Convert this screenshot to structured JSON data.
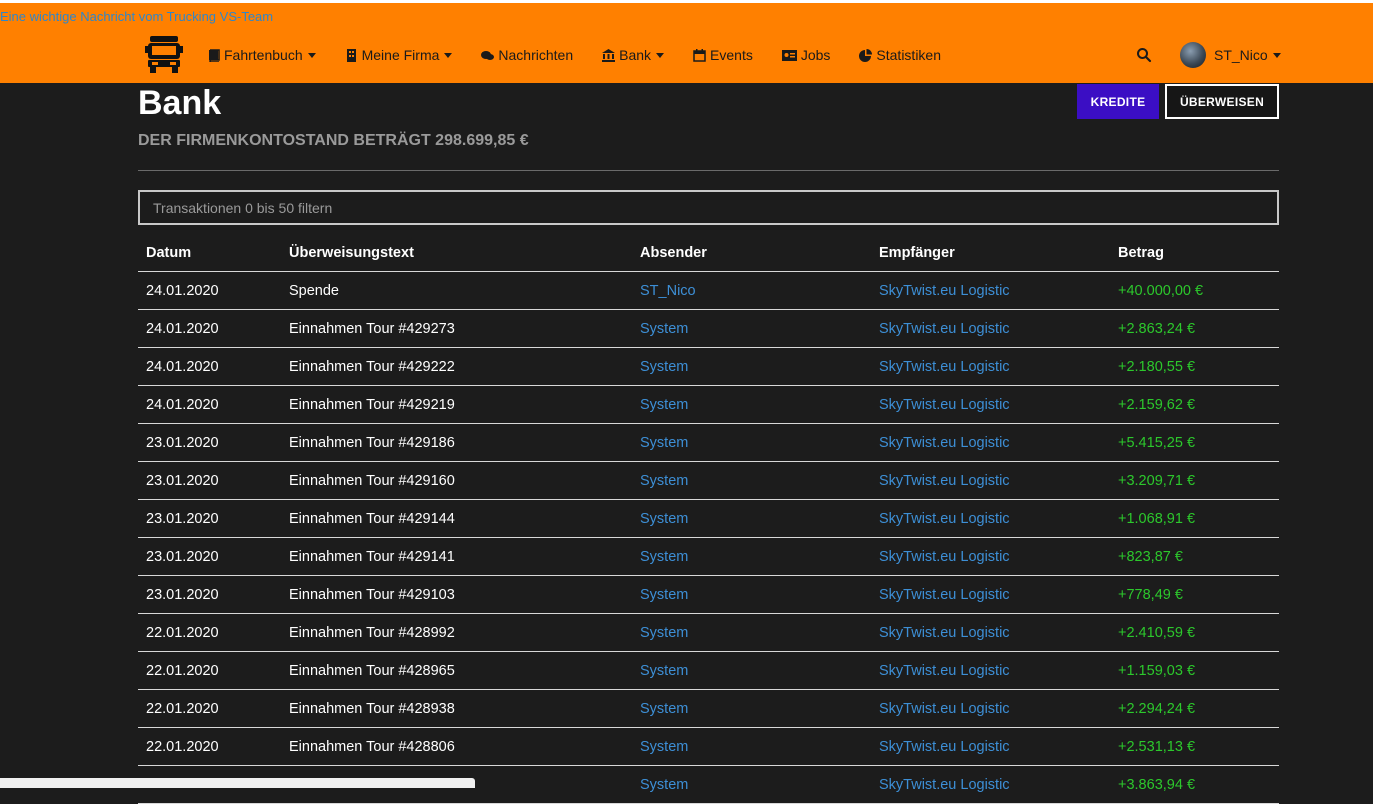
{
  "notice": "Eine wichtige Nachricht vom Trucking VS-Team",
  "nav": {
    "items": [
      {
        "label": "Fahrtenbuch",
        "icon": "book-icon",
        "dropdown": true
      },
      {
        "label": "Meine Firma",
        "icon": "building-icon",
        "dropdown": true
      },
      {
        "label": "Nachrichten",
        "icon": "chat-icon",
        "dropdown": false
      },
      {
        "label": "Bank",
        "icon": "bank-icon",
        "dropdown": true
      },
      {
        "label": "Events",
        "icon": "calendar-icon",
        "dropdown": false
      },
      {
        "label": "Jobs",
        "icon": "id-card-icon",
        "dropdown": false
      },
      {
        "label": "Statistiken",
        "icon": "pie-chart-icon",
        "dropdown": false
      }
    ],
    "user": "ST_Nico"
  },
  "page": {
    "title": "Bank",
    "balance": "Der Firmenkontostand beträgt 298.699,85 €",
    "kredite_label": "KREDITE",
    "ueberweisen_label": "ÜBERWEISEN",
    "filter_placeholder": "Transaktionen 0 bis 50 filtern"
  },
  "table": {
    "columns": [
      "Datum",
      "Überweisungstext",
      "Absender",
      "Empfänger",
      "Betrag"
    ],
    "rows": [
      [
        "24.01.2020",
        "Spende",
        "ST_Nico",
        "SkyTwist.eu Logistic",
        "+40.000,00 €"
      ],
      [
        "24.01.2020",
        "Einnahmen Tour #429273",
        "System",
        "SkyTwist.eu Logistic",
        "+2.863,24 €"
      ],
      [
        "24.01.2020",
        "Einnahmen Tour #429222",
        "System",
        "SkyTwist.eu Logistic",
        "+2.180,55 €"
      ],
      [
        "24.01.2020",
        "Einnahmen Tour #429219",
        "System",
        "SkyTwist.eu Logistic",
        "+2.159,62 €"
      ],
      [
        "23.01.2020",
        "Einnahmen Tour #429186",
        "System",
        "SkyTwist.eu Logistic",
        "+5.415,25 €"
      ],
      [
        "23.01.2020",
        "Einnahmen Tour #429160",
        "System",
        "SkyTwist.eu Logistic",
        "+3.209,71 €"
      ],
      [
        "23.01.2020",
        "Einnahmen Tour #429144",
        "System",
        "SkyTwist.eu Logistic",
        "+1.068,91 €"
      ],
      [
        "23.01.2020",
        "Einnahmen Tour #429141",
        "System",
        "SkyTwist.eu Logistic",
        "+823,87 €"
      ],
      [
        "23.01.2020",
        "Einnahmen Tour #429103",
        "System",
        "SkyTwist.eu Logistic",
        "+778,49 €"
      ],
      [
        "22.01.2020",
        "Einnahmen Tour #428992",
        "System",
        "SkyTwist.eu Logistic",
        "+2.410,59 €"
      ],
      [
        "22.01.2020",
        "Einnahmen Tour #428965",
        "System",
        "SkyTwist.eu Logistic",
        "+1.159,03 €"
      ],
      [
        "22.01.2020",
        "Einnahmen Tour #428938",
        "System",
        "SkyTwist.eu Logistic",
        "+2.294,24 €"
      ],
      [
        "22.01.2020",
        "Einnahmen Tour #428806",
        "System",
        "SkyTwist.eu Logistic",
        "+2.531,13 €"
      ],
      [
        "",
        "",
        "System",
        "SkyTwist.eu Logistic",
        "+3.863,94 €"
      ]
    ]
  },
  "colors": {
    "navbar": "#ff8000",
    "background": "#1c1c1c",
    "link": "#3d8fd6",
    "positive_amount": "#2cc82c",
    "kredite_button": "#3b0ec4"
  }
}
